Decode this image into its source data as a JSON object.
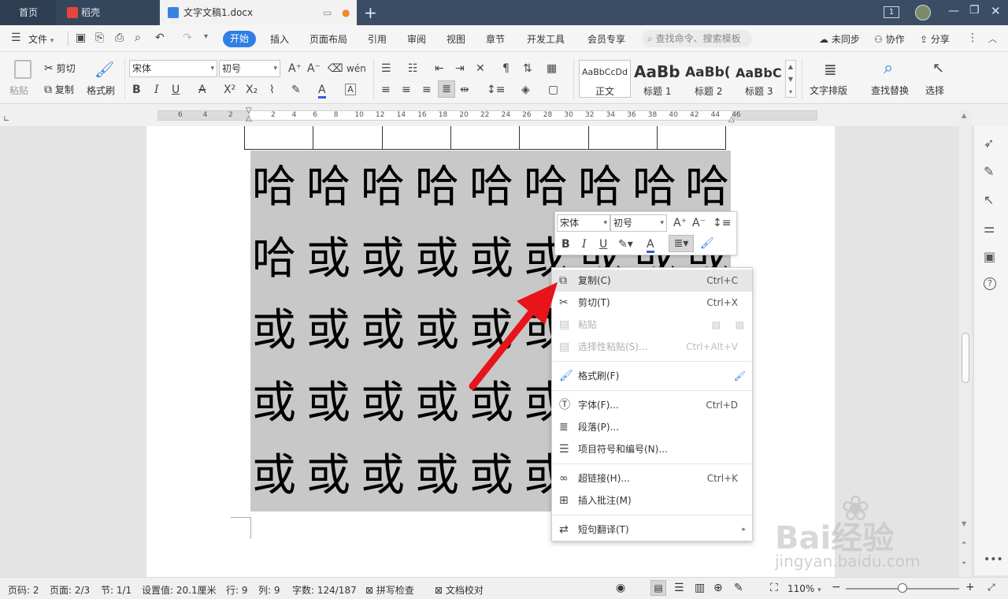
{
  "titlebar": {
    "tab_home": "首页",
    "tab_daoke": "稻壳",
    "tab_doc": "文字文稿1.docx",
    "badge": "1"
  },
  "menubar": {
    "file": "文件",
    "items": [
      "开始",
      "插入",
      "页面布局",
      "引用",
      "审阅",
      "视图",
      "章节",
      "开发工具",
      "会员专享"
    ],
    "search_placeholder": "查找命令、搜索模板",
    "unsynced": "未同步",
    "collab": "协作",
    "share": "分享"
  },
  "ribbon": {
    "paste": "粘贴",
    "cut": "剪切",
    "copy": "复制",
    "format_painter": "格式刷",
    "font_name": "宋体",
    "font_size": "初号",
    "styles": [
      {
        "preview": "AaBbCcDd",
        "label": "正文"
      },
      {
        "preview": "AaBb",
        "label": "标题 1"
      },
      {
        "preview": "AaBb(",
        "label": "标题 2"
      },
      {
        "preview": "AaBbC",
        "label": "标题 3"
      }
    ],
    "text_layout": "文字排版",
    "find_replace": "查找替换",
    "select": "选择"
  },
  "ruler": {
    "ticks": [
      "6",
      "4",
      "2",
      "2",
      "4",
      "6",
      "8",
      "10",
      "12",
      "14",
      "16",
      "18",
      "20",
      "22",
      "24",
      "26",
      "28",
      "30",
      "32",
      "34",
      "36",
      "38",
      "40",
      "42",
      "44",
      "46"
    ]
  },
  "document": {
    "row1": [
      "哈",
      "哈",
      "哈",
      "哈",
      "哈",
      "哈",
      "哈",
      "哈",
      "哈"
    ],
    "row2": [
      "哈",
      "或",
      "或",
      "或",
      "或",
      "或",
      "或",
      "或",
      "或"
    ],
    "row3": [
      "或",
      "或",
      "或",
      "或",
      "或",
      "或"
    ],
    "row4": [
      "或",
      "或",
      "或",
      "或",
      "或",
      "或"
    ],
    "row5": [
      "或",
      "或",
      "或",
      "或",
      "或",
      "或"
    ]
  },
  "minitoolbar": {
    "font_name": "宋体",
    "font_size": "初号"
  },
  "context_menu": {
    "items": [
      {
        "label": "复制(C)",
        "shortcut": "Ctrl+C"
      },
      {
        "label": "剪切(T)",
        "shortcut": "Ctrl+X"
      },
      {
        "label": "粘贴",
        "shortcut": ""
      },
      {
        "label": "选择性粘贴(S)...",
        "shortcut": "Ctrl+Alt+V"
      },
      {
        "label": "格式刷(F)",
        "shortcut": ""
      },
      {
        "label": "字体(F)...",
        "shortcut": "Ctrl+D"
      },
      {
        "label": "段落(P)...",
        "shortcut": ""
      },
      {
        "label": "项目符号和编号(N)...",
        "shortcut": ""
      },
      {
        "label": "超链接(H)...",
        "shortcut": "Ctrl+K"
      },
      {
        "label": "插入批注(M)",
        "shortcut": ""
      },
      {
        "label": "短句翻译(T)",
        "shortcut": ""
      }
    ]
  },
  "statusbar": {
    "page_no": "页码: 2",
    "pages": "页面: 2/3",
    "section": "节: 1/1",
    "position": "设置值: 20.1厘米",
    "row": "行: 9",
    "col": "列: 9",
    "words": "字数: 124/187",
    "spell": "拼写检查",
    "proof": "文档校对",
    "zoom": "110%"
  },
  "watermark": {
    "brand": "Bai经验",
    "url": "jingyan.baidu.com"
  },
  "colors": {
    "titlebar": "#3a4d65",
    "accent": "#2f7fe6",
    "selection": "#c8c8c8",
    "arrow": "#e8141b"
  }
}
